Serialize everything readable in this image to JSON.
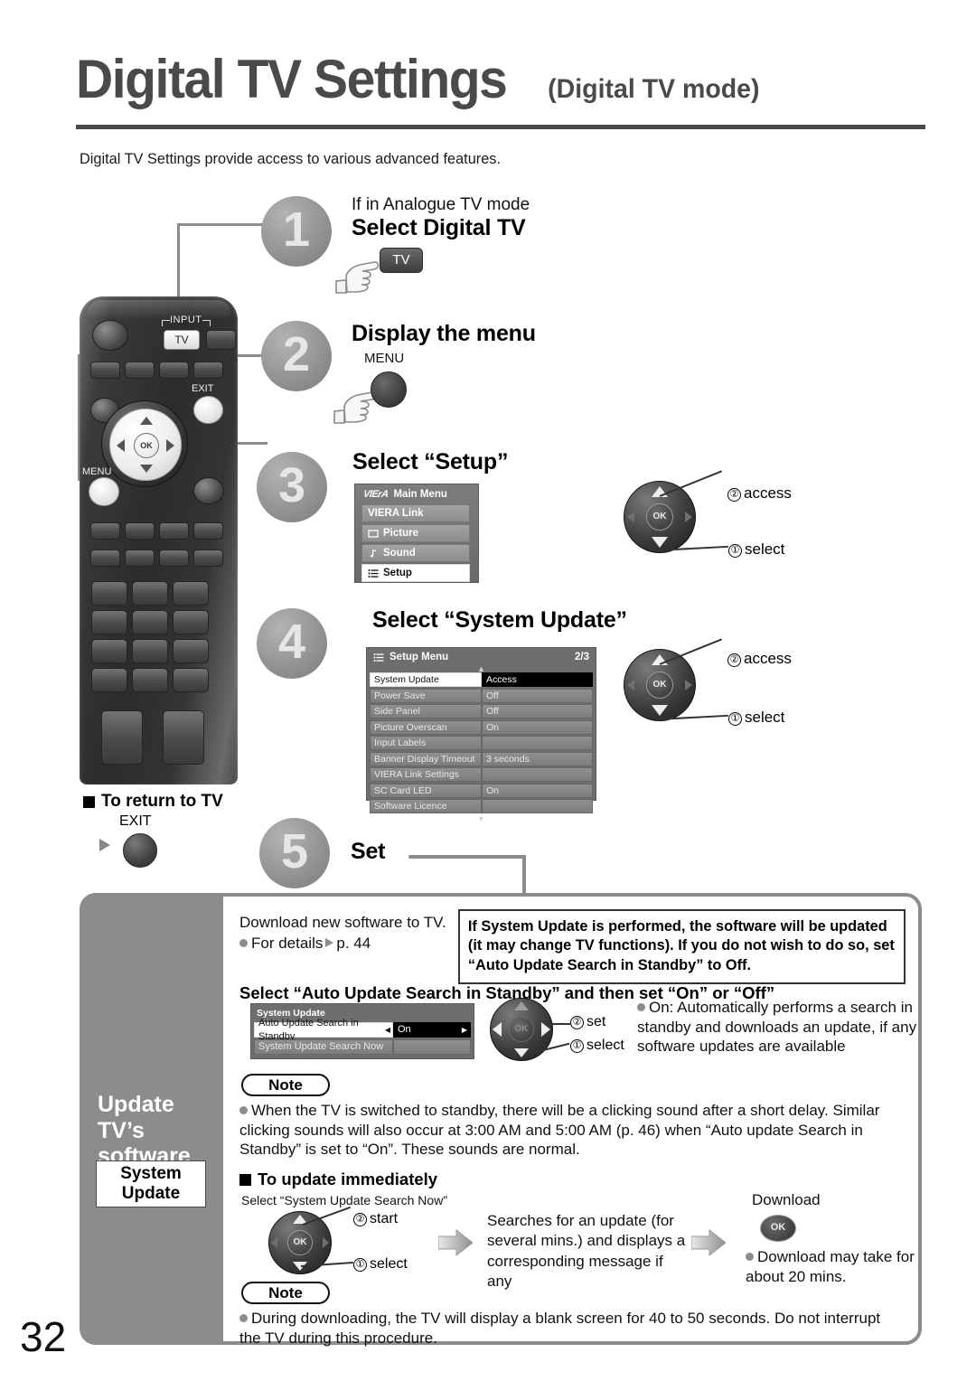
{
  "header": {
    "title": "Digital TV Settings",
    "mode": "(Digital TV mode)",
    "intro": "Digital TV Settings provide access to various advanced features."
  },
  "steps": [
    {
      "number": "1",
      "lead": "If in Analogue TV mode",
      "heading": "Select Digital TV",
      "key_label": "TV"
    },
    {
      "number": "2",
      "heading": "Display the menu",
      "key_label": "MENU"
    },
    {
      "number": "3",
      "heading": "Select “Setup”",
      "actions": [
        {
          "num": "②",
          "label": "access"
        },
        {
          "num": "①",
          "label": "select"
        }
      ]
    },
    {
      "number": "4",
      "heading": "Select “System Update”",
      "actions": [
        {
          "num": "②",
          "label": "access"
        },
        {
          "num": "①",
          "label": "select"
        }
      ]
    },
    {
      "number": "5",
      "heading": "Set"
    }
  ],
  "main_menu": {
    "brand": "VIErA",
    "title": "Main Menu",
    "items": [
      {
        "label": "VIERA Link",
        "icon": "link-icon",
        "selected": false
      },
      {
        "label": "Picture",
        "icon": "picture-icon",
        "selected": false
      },
      {
        "label": "Sound",
        "icon": "note-icon",
        "selected": false
      },
      {
        "label": "Setup",
        "icon": "list-icon",
        "selected": true
      }
    ]
  },
  "setup_menu": {
    "title": "Setup Menu",
    "page_indicator": "2/3",
    "rows": [
      {
        "name": "System Update",
        "value": "Access",
        "selected": true
      },
      {
        "name": "Power Save",
        "value": "Off",
        "selected": false
      },
      {
        "name": "Side Panel",
        "value": "Off",
        "selected": false
      },
      {
        "name": "Picture Overscan",
        "value": "On",
        "selected": false
      },
      {
        "name": "Input Labels",
        "value": "",
        "selected": false
      },
      {
        "name": "Banner Display Timeout",
        "value": "3 seconds",
        "selected": false
      },
      {
        "name": "VIERA Link Settings",
        "value": "",
        "selected": false
      },
      {
        "name": "SC Card LED",
        "value": "On",
        "selected": false
      },
      {
        "name": "Software Licence",
        "value": "",
        "selected": false
      }
    ]
  },
  "remote": {
    "tv_button": "TV",
    "input_label": "INPUT",
    "exit_label": "EXIT",
    "menu_label": "MENU",
    "ok_label": "OK"
  },
  "return_to_tv": {
    "heading": "To return to TV",
    "key_label": "EXIT"
  },
  "panel": {
    "side_title": "Update\nTV’s\nsoftware\nsystem",
    "side_box_line1": "System",
    "side_box_line2": "Update",
    "download_line1": "Download new software to TV.",
    "download_line2_a": "For details",
    "download_line2_b": "p. 44",
    "warning": "If System Update is performed, the software will be updated (it may change TV functions). If you do not wish to do so, set “Auto Update Search in Standby” to Off.",
    "section1_heading": "Select “Auto Update Search in Standby” and then set “On” or “Off”",
    "sysupd_osd": {
      "title": "System Update",
      "rows": [
        {
          "name": "Auto Update Search in Standby",
          "value": "On",
          "selected": true
        },
        {
          "name": "System Update Search Now",
          "value": "",
          "selected": false
        }
      ]
    },
    "sysupd_actions": [
      {
        "num": "②",
        "label": "set"
      },
      {
        "num": "①",
        "label": "select"
      }
    ],
    "on_description": "On: Automatically performs a search in standby and downloads an update, if any software updates are available",
    "note1_label": "Note",
    "note1_text": "When the TV is switched to standby, there will be a clicking sound after a short delay. Similar clicking sounds will also occur at 3:00 AM and 5:00 AM (p. 46) when “Auto update Search in Standby” is set to “On”. These sounds are normal.",
    "section2_heading": "To update immediately",
    "search_now_caption": "Select “System Update Search Now”",
    "search_now_actions": [
      {
        "num": "②",
        "label": "start"
      },
      {
        "num": "①",
        "label": "select"
      }
    ],
    "search_result": "Searches for an update (for several mins.) and displays a corresponding message if any",
    "download_label": "Download",
    "download_ok": "OK",
    "download_note": "Download may take for about 20 mins.",
    "note2_label": "Note",
    "note2_text": "During downloading, the TV will display a blank screen for 40 to 50 seconds. Do not interrupt the TV during this procedure."
  },
  "page_number": "32",
  "colors": {
    "gray_accent": "#8c8c8c",
    "title_gray": "#4a4a4a",
    "osd_gray": "#6e6e6e"
  }
}
